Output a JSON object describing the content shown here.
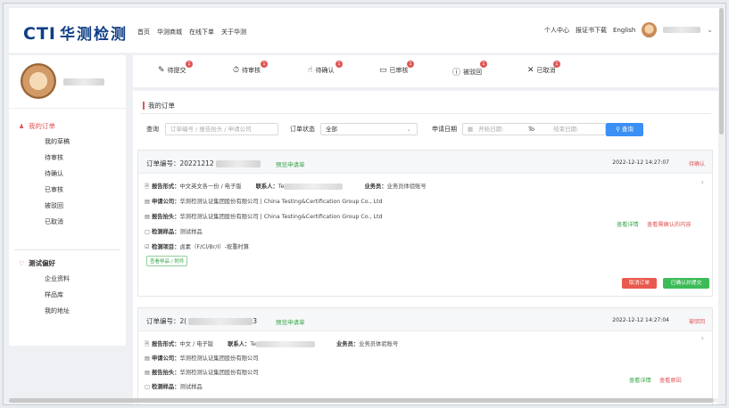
{
  "brand": {
    "logo_cti": "CTI",
    "logo_cn": "华测检测"
  },
  "nav": [
    "首页",
    "华测商城",
    "在线下单",
    "关于华测"
  ],
  "topright": {
    "personal_center": "个人中心",
    "cert_download": "报证书下载",
    "language": "English"
  },
  "sidebar": {
    "orders_head": "我的订单",
    "orders_items": [
      "我的草稿",
      "待审核",
      "待确认",
      "已审核",
      "被驳回",
      "已取消"
    ],
    "prefs_head": "测试偏好",
    "prefs_items": [
      "企业资料",
      "样品库",
      "我的地址"
    ]
  },
  "tabs": [
    {
      "label": "待提交",
      "icon": "edit-icon",
      "glyph": "✎",
      "badge": "1"
    },
    {
      "label": "待审核",
      "icon": "timer-icon",
      "glyph": "⏱",
      "badge": "1"
    },
    {
      "label": "待确认",
      "icon": "hand-icon",
      "glyph": "☝",
      "badge": "1"
    },
    {
      "label": "已审核",
      "icon": "monitor-icon",
      "glyph": "▭",
      "badge": "1"
    },
    {
      "label": "被驳回",
      "icon": "alert-icon",
      "glyph": "ⓘ",
      "badge": "1"
    },
    {
      "label": "已取消",
      "icon": "close-icon",
      "glyph": "✕",
      "badge": "1"
    }
  ],
  "panel_title": "我的订单",
  "filter": {
    "query_label": "查询",
    "query_placeholder": "订单编号 / 报告抬头 / 申请公司",
    "status_label": "订单状态",
    "status_value": "全部",
    "date_label": "申请日期",
    "start_placeholder": "开始日期:",
    "to_label": "To",
    "end_placeholder": "结束日期:",
    "query_button": "查询"
  },
  "orders": [
    {
      "no_label": "订单编号：",
      "no_prefix": "20221212",
      "preview": "预览申请单",
      "date": "2022-12-12 14:27:07",
      "status": "待确认",
      "format_label": "报告形式：",
      "format_value": "中文英文各一份 / 电子版",
      "contact_label": "联系人：",
      "contact_prefix": "Te",
      "sales_label": "业务员：",
      "sales_value": "业务员体验账号",
      "company_label": "申请公司：",
      "company_value": "华测检测认证集团股份有限公司 | China Testing&Certification Group Co., Ltd",
      "header_label": "报告抬头：",
      "header_value": "华测检测认证集团股份有限公司 | China Testing&Certification Group Co., Ltd",
      "sample_label": "检测样品：",
      "sample_value": "测试样品",
      "items_label": "检测项目：",
      "items_value": "卤素（F/Cl/Br/I）-按重时算",
      "tag": "查看样品 / 附件",
      "link_detail": "查看详情",
      "link_other": "查看需确认的内容",
      "btn_cancel": "取消订单",
      "btn_confirm": "已确认并提交"
    },
    {
      "no_label": "订单编号：",
      "no_prefix": "2(",
      "no_suffix": "3",
      "preview": "预览申请单",
      "date": "2022-12-12 14:27:04",
      "status": "被驳回",
      "format_label": "报告形式：",
      "format_value": "中文 / 电子版",
      "contact_label": "联系人：",
      "contact_prefix": "Te",
      "sales_label": "业务员：",
      "sales_value": "业务员体验账号",
      "company_label": "申请公司：",
      "company_value": "华测检测认证集团股份有限公司",
      "header_label": "报告抬头：",
      "header_value": "华测检测认证集团股份有限公司",
      "sample_label": "检测样品：",
      "sample_value": "测试样品",
      "link_detail": "查看详情",
      "link_other": "查看原因"
    }
  ]
}
